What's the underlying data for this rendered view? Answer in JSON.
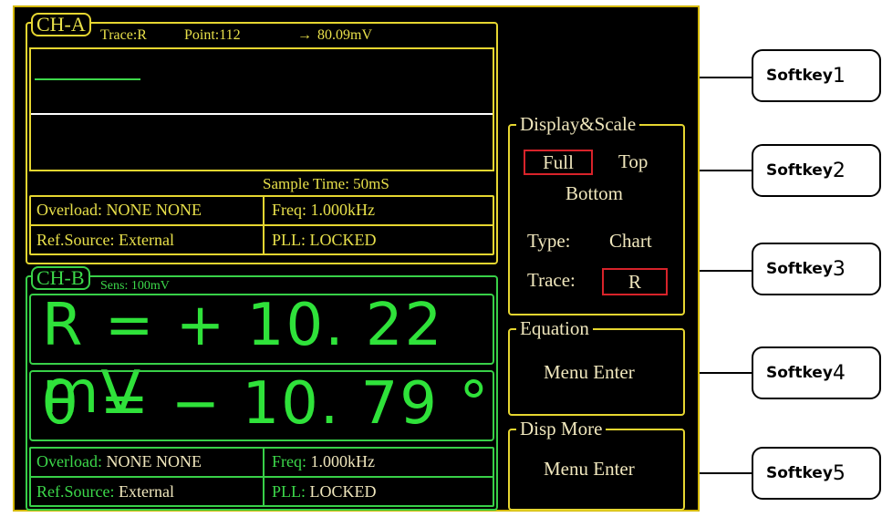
{
  "ch_a": {
    "tag": "CH-A",
    "trace": "Trace:R",
    "point": "Point:112",
    "arrow": "→",
    "value": "80.09mV",
    "sample_time": "Sample Time:  50mS",
    "overload": "Overload: NONE  NONE",
    "freq": "Freq:  1.000kHz",
    "ref_source": "Ref.Source: External",
    "pll": "PLL:  LOCKED",
    "trace_color": "#3cd84a",
    "baseline_color": "#ffffff"
  },
  "ch_b": {
    "tag": "CH-B",
    "sens": "Sens: 100mV",
    "r_line": "R = +  10. 22 mV",
    "theta_line": "θ = −  10. 79 °",
    "overload_label": "Overload:",
    "overload_value": " NONE  NONE",
    "freq_label": "Freq:",
    "freq_value": "  1.000kHz",
    "ref_label": "Ref.Source:",
    "ref_value": " External",
    "pll_label": "PLL:",
    "pll_value": "  LOCKED"
  },
  "display_scale": {
    "title": "Display&Scale",
    "full": "Full",
    "top": "Top",
    "bottom": "Bottom",
    "type_label": "Type:",
    "type_value": "Chart",
    "trace_label": "Trace:",
    "trace_value": "R"
  },
  "equation": {
    "title": "Equation",
    "action": "Menu Enter"
  },
  "disp_more": {
    "title": "Disp More",
    "action": "Menu Enter"
  },
  "softkeys": [
    {
      "label": "Softkey",
      "num": "1"
    },
    {
      "label": "Softkey",
      "num": "2"
    },
    {
      "label": "Softkey",
      "num": "3"
    },
    {
      "label": "Softkey",
      "num": "4"
    },
    {
      "label": "Softkey",
      "num": "5"
    }
  ],
  "colors": {
    "yellow": "#e6d630",
    "green": "#38d048",
    "selected_border": "#d8232a",
    "screen_bg": "#000000"
  }
}
